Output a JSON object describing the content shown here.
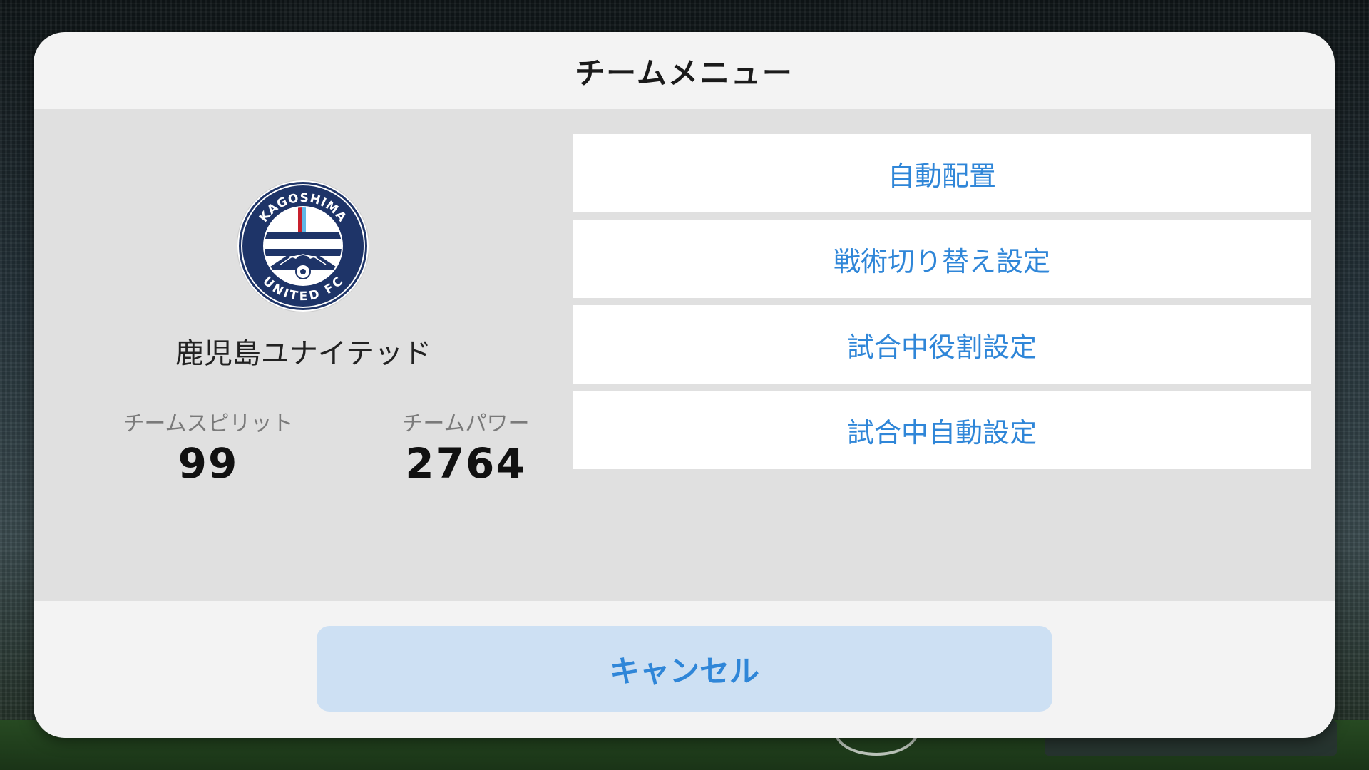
{
  "dialog": {
    "title": "チームメニュー"
  },
  "team": {
    "name": "鹿児島ユナイテッド",
    "emblem": {
      "top_text": "KAGOSHIMA",
      "bottom_text": "UNITED FC",
      "colors": {
        "navy": "#1e3468",
        "red": "#c8202d",
        "sky": "#5fb8e6",
        "white": "#ffffff"
      }
    },
    "spirit": {
      "label": "チームスピリット",
      "value": "99"
    },
    "power": {
      "label": "チームパワー",
      "value": "2764"
    }
  },
  "menu": {
    "items": [
      {
        "label": "自動配置"
      },
      {
        "label": "戦術切り替え設定"
      },
      {
        "label": "試合中役割設定"
      },
      {
        "label": "試合中自動設定"
      }
    ]
  },
  "footer": {
    "cancel_label": "キャンセル"
  },
  "colors": {
    "accent": "#2f86d8",
    "cancel_bg": "#cde0f3",
    "body_bg": "#e0e0e0",
    "dialog_bg": "#f3f3f3"
  }
}
